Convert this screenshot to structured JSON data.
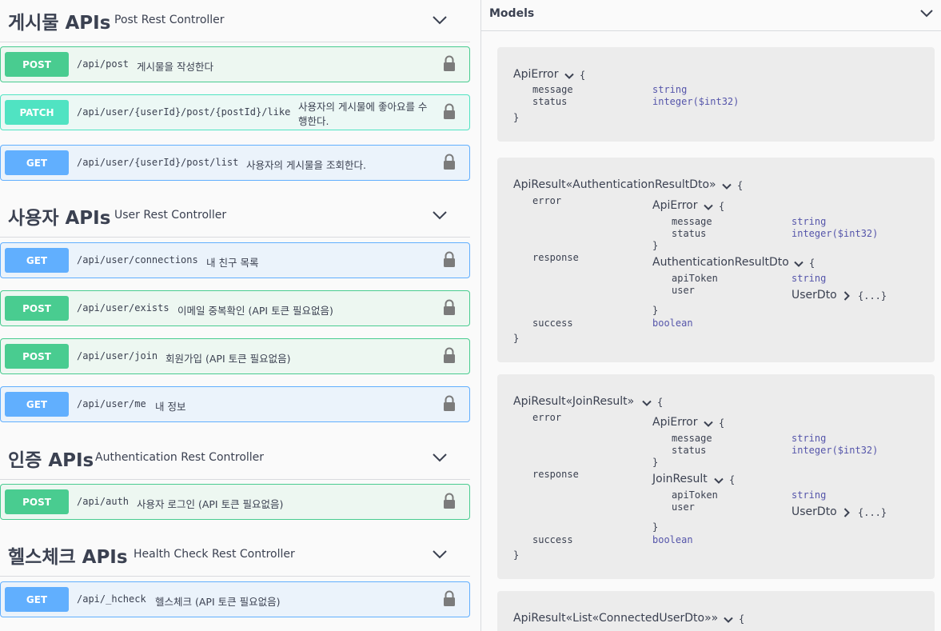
{
  "tags": [
    {
      "name": "게시물 APIs",
      "description": "Post Rest Controller",
      "operations": [
        {
          "method": "POST",
          "path": "/api/post",
          "summary": "게시물을 작성한다"
        },
        {
          "method": "PATCH",
          "path": "/api/user/{userId}/post/{postId}/like",
          "summary": "사용자의 게시물에 좋아요를 수행한다."
        },
        {
          "method": "GET",
          "path": "/api/user/{userId}/post/list",
          "summary": "사용자의 게시물을 조회한다."
        }
      ]
    },
    {
      "name": "사용자 APIs",
      "description": "User Rest Controller",
      "operations": [
        {
          "method": "GET",
          "path": "/api/user/connections",
          "summary": "내 친구 목록"
        },
        {
          "method": "POST",
          "path": "/api/user/exists",
          "summary": "이메일 중복확인 (API 토큰 필요없음)"
        },
        {
          "method": "POST",
          "path": "/api/user/join",
          "summary": "회원가입 (API 토큰 필요없음)"
        },
        {
          "method": "GET",
          "path": "/api/user/me",
          "summary": "내 정보"
        }
      ]
    },
    {
      "name": "인증 APIs",
      "description": "Authentication Rest Controller",
      "operations": [
        {
          "method": "POST",
          "path": "/api/auth",
          "summary": "사용자 로그인 (API 토큰 필요없음)"
        }
      ]
    },
    {
      "name": "헬스체크 APIs",
      "description": "Health Check Rest Controller",
      "operations": [
        {
          "method": "GET",
          "path": "/api/_hcheck",
          "summary": "헬스체크 (API 토큰 필요없음)"
        }
      ]
    }
  ],
  "models": {
    "title": "Models",
    "items": [
      {
        "name": "ApiError",
        "props": [
          {
            "name": "message",
            "type": "string"
          },
          {
            "name": "status",
            "type": "integer($int32)"
          }
        ]
      },
      {
        "name": "ApiResult«AuthenticationResultDto»",
        "error_model": "ApiError",
        "error_props": [
          {
            "name": "message",
            "type": "string"
          },
          {
            "name": "status",
            "type": "integer($int32)"
          }
        ],
        "response_model": "AuthenticationResultDto",
        "response_props": [
          {
            "name": "apiToken",
            "type": "string"
          },
          {
            "name": "user",
            "type": "UserDto"
          }
        ]
      },
      {
        "name": "ApiResult«JoinResult»",
        "error_model": "ApiError",
        "error_props": [
          {
            "name": "message",
            "type": "string"
          },
          {
            "name": "status",
            "type": "integer($int32)"
          }
        ],
        "response_model": "JoinResult",
        "response_props": [
          {
            "name": "apiToken",
            "type": "string"
          },
          {
            "name": "user",
            "type": "UserDto"
          }
        ]
      },
      {
        "name": "ApiResult«List«ConnectedUserDto»»"
      }
    ],
    "labels": {
      "error": "error",
      "response": "response",
      "success": "success",
      "success_type": "boolean",
      "open_brace": "{",
      "close_brace": "}",
      "collapsed": "{...}"
    }
  },
  "colors": {
    "post": "#49cc90",
    "patch": "#50e3c2",
    "get": "#61affe",
    "prop_type": "#55a"
  },
  "icons": {
    "tag_toggle": "chevron-down-icon",
    "auth": "lock-icon",
    "model_toggle": "chevron-down-icon",
    "expand": "chevron-right-icon"
  }
}
